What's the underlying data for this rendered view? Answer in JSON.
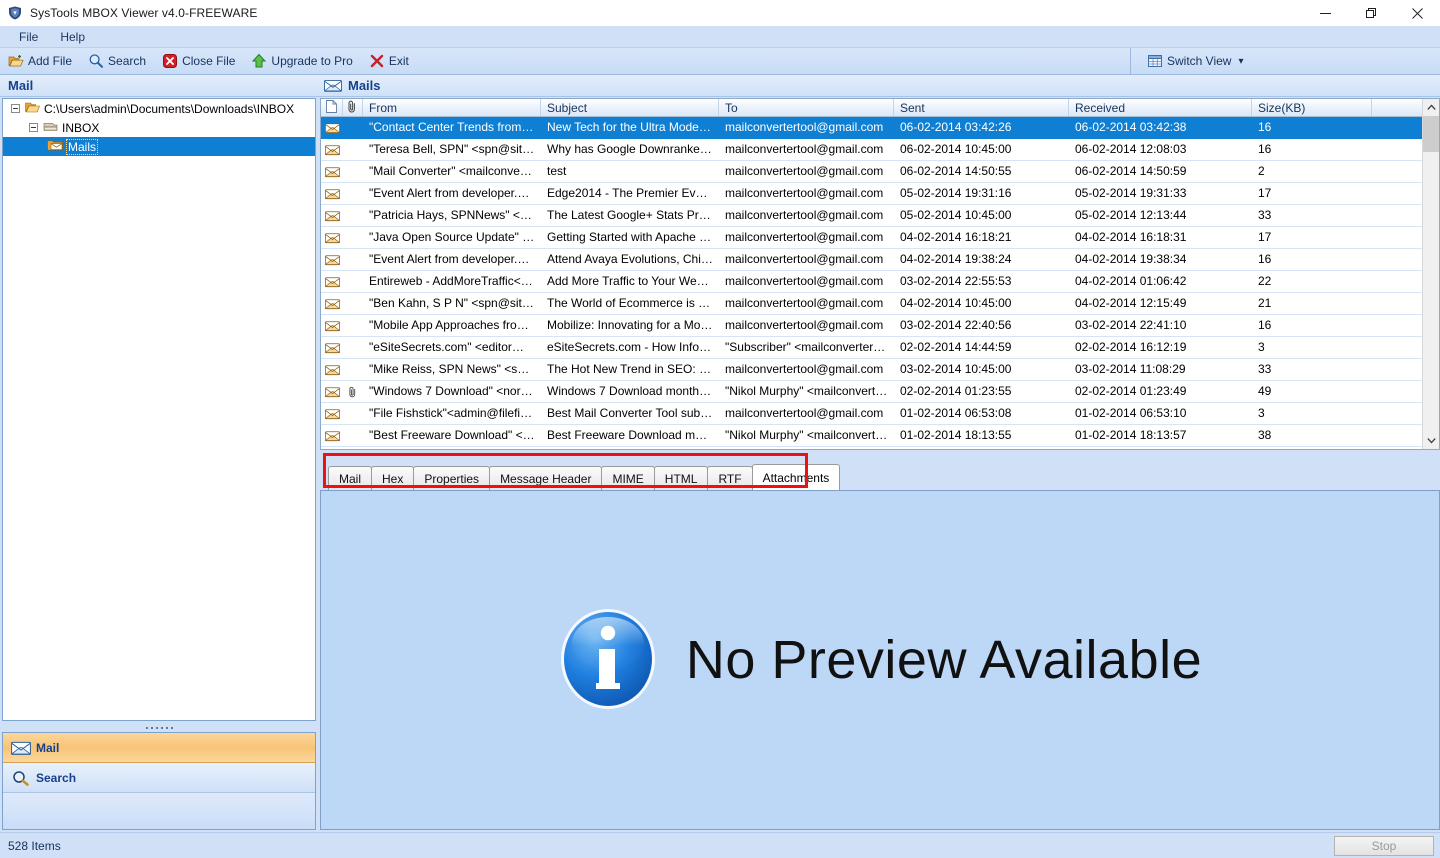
{
  "window": {
    "title": "SysTools MBOX Viewer v4.0-FREEWARE",
    "app_icon": "shield-icon",
    "minimize_label": "Minimize",
    "maximize_label": "Restore",
    "close_label": "Close"
  },
  "menubar": {
    "items": [
      {
        "label": "File",
        "name": "menu-file"
      },
      {
        "label": "Help",
        "name": "menu-help"
      }
    ]
  },
  "toolbar": {
    "buttons": [
      {
        "label": "Add File",
        "icon": "open-folder-icon"
      },
      {
        "label": "Search",
        "icon": "magnifier-icon"
      },
      {
        "label": "Close File",
        "icon": "close-red-icon"
      },
      {
        "label": "Upgrade to Pro",
        "icon": "green-up-arrow-icon"
      },
      {
        "label": "Exit",
        "icon": "red-x-icon"
      }
    ],
    "switch_view": {
      "label": "Switch View",
      "icon": "grid-icon",
      "caret": "▾"
    }
  },
  "left_pane": {
    "header": "Mail",
    "tree": [
      {
        "label": "C:\\Users\\admin\\Documents\\Downloads\\INBOX",
        "level": 1,
        "icon": "folder-icon",
        "expanded": true,
        "selected": false
      },
      {
        "label": "INBOX",
        "level": 2,
        "icon": "mbox-file-icon",
        "expanded": true,
        "selected": false
      },
      {
        "label": "Mails",
        "level": 3,
        "icon": "mail-folder-icon",
        "expanded": false,
        "selected": true
      }
    ],
    "nav_buttons": [
      {
        "label": "Mail",
        "icon": "envelope-icon",
        "active": true
      },
      {
        "label": "Search",
        "icon": "magnifier-icon",
        "active": false
      }
    ]
  },
  "mail_list": {
    "header": "Mails",
    "header_icon": "envelope-icon",
    "columns": [
      {
        "key": "icon",
        "label": "",
        "cls": "c-icon"
      },
      {
        "key": "clip",
        "label": "",
        "cls": "c-clip"
      },
      {
        "key": "from",
        "label": "From",
        "cls": "c-from"
      },
      {
        "key": "subject",
        "label": "Subject",
        "cls": "c-subject"
      },
      {
        "key": "to",
        "label": "To",
        "cls": "c-to"
      },
      {
        "key": "sent",
        "label": "Sent",
        "cls": "c-sent"
      },
      {
        "key": "received",
        "label": "Received",
        "cls": "c-recv"
      },
      {
        "key": "size",
        "label": "Size(KB)",
        "cls": "c-size"
      }
    ],
    "rows": [
      {
        "selected": true,
        "attachment": false,
        "from": "\"Contact Center Trends from de...",
        "subject": "New Tech for the Ultra Modern...",
        "to": "mailconvertertool@gmail.com",
        "sent": "06-02-2014 03:42:26",
        "received": "06-02-2014 03:42:38",
        "size": "16"
      },
      {
        "selected": false,
        "attachment": false,
        "from": "\"Teresa Bell, SPN\" <spn@sitepr...",
        "subject": "Why has Google Downranked ...",
        "to": "mailconvertertool@gmail.com",
        "sent": "06-02-2014 10:45:00",
        "received": "06-02-2014 12:08:03",
        "size": "16"
      },
      {
        "selected": false,
        "attachment": false,
        "from": "\"Mail Converter\" <mailconverte...",
        "subject": "test",
        "to": "mailconvertertool@gmail.com",
        "sent": "06-02-2014 14:50:55",
        "received": "06-02-2014 14:50:59",
        "size": "2"
      },
      {
        "selected": false,
        "attachment": false,
        "from": "\"Event Alert from developer.co...",
        "subject": "Edge2014 - The Premier Event f...",
        "to": "mailconvertertool@gmail.com",
        "sent": "05-02-2014 19:31:16",
        "received": "05-02-2014 19:31:33",
        "size": "17"
      },
      {
        "selected": false,
        "attachment": false,
        "from": "\"Patricia Hays, SPNNews\" <spn...",
        "subject": "The Latest Google+ Stats Prove...",
        "to": "mailconvertertool@gmail.com",
        "sent": "05-02-2014 10:45:00",
        "received": "05-02-2014 12:13:44",
        "size": "33"
      },
      {
        "selected": false,
        "attachment": false,
        "from": "\"Java Open Source Update\" <n...",
        "subject": "Getting Started with Apache H...",
        "to": "mailconvertertool@gmail.com",
        "sent": "04-02-2014 16:18:21",
        "received": "04-02-2014 16:18:31",
        "size": "17"
      },
      {
        "selected": false,
        "attachment": false,
        "from": "\"Event Alert from developer.co...",
        "subject": "Attend Avaya Evolutions, Chica...",
        "to": "mailconvertertool@gmail.com",
        "sent": "04-02-2014 19:38:24",
        "received": "04-02-2014 19:38:34",
        "size": "16"
      },
      {
        "selected": false,
        "attachment": false,
        "from": "Entireweb - AddMoreTraffic<d...",
        "subject": "Add More Traffic to Your Websi...",
        "to": "mailconvertertool@gmail.com",
        "sent": "03-02-2014 22:55:53",
        "received": "04-02-2014 01:06:42",
        "size": "22"
      },
      {
        "selected": false,
        "attachment": false,
        "from": "\"Ben Kahn, S P N\" <spn@sitepr...",
        "subject": "The World of Ecommerce is Ch...",
        "to": "mailconvertertool@gmail.com",
        "sent": "04-02-2014 10:45:00",
        "received": "04-02-2014 12:15:49",
        "size": "21"
      },
      {
        "selected": false,
        "attachment": false,
        "from": "\"Mobile App Approaches from ...",
        "subject": "Mobilize: Innovating for a Mob...",
        "to": "mailconvertertool@gmail.com",
        "sent": "03-02-2014 22:40:56",
        "received": "03-02-2014 22:41:10",
        "size": "16"
      },
      {
        "selected": false,
        "attachment": false,
        "from": "\"eSiteSecrets.com\" <editor@esi...",
        "subject": "eSiteSecrets.com - How Inform...",
        "to": "\"Subscriber\" <mailconvertertoo...",
        "sent": "02-02-2014 14:44:59",
        "received": "02-02-2014 16:12:19",
        "size": "3"
      },
      {
        "selected": false,
        "attachment": false,
        "from": "\"Mike Reiss, SPN News\" <spn@...",
        "subject": "The Hot New Trend in SEO: Se...",
        "to": "mailconvertertool@gmail.com",
        "sent": "03-02-2014 10:45:00",
        "received": "03-02-2014 11:08:29",
        "size": "33"
      },
      {
        "selected": false,
        "attachment": true,
        "from": "\"Windows 7 Download\" <nore...",
        "subject": "Windows 7 Download monthly...",
        "to": "\"Nikol Murphy\" <mailconverter...",
        "sent": "02-02-2014 01:23:55",
        "received": "02-02-2014 01:23:49",
        "size": "49"
      },
      {
        "selected": false,
        "attachment": false,
        "from": "\"File Fishstick\"<admin@filefish...",
        "subject": "Best Mail Converter Tool submi...",
        "to": "mailconvertertool@gmail.com",
        "sent": "01-02-2014 06:53:08",
        "received": "01-02-2014 06:53:10",
        "size": "3"
      },
      {
        "selected": false,
        "attachment": false,
        "from": "\"Best Freeware Download\" <n...",
        "subject": "Best Freeware Download mont...",
        "to": "\"Nikol Murphy\" <mailconverter...",
        "sent": "01-02-2014 18:13:55",
        "received": "01-02-2014 18:13:57",
        "size": "38"
      }
    ],
    "scrollbar": {
      "up_arrow": "˄",
      "down_arrow": "˅"
    }
  },
  "tabs": {
    "highlighted": true,
    "highlight_color": "#ee1111",
    "items": [
      {
        "label": "Mail",
        "active": false
      },
      {
        "label": "Hex",
        "active": false
      },
      {
        "label": "Properties",
        "active": false
      },
      {
        "label": "Message Header",
        "active": false
      },
      {
        "label": "MIME",
        "active": false
      },
      {
        "label": "HTML",
        "active": false
      },
      {
        "label": "RTF",
        "active": false
      },
      {
        "label": "Attachments",
        "active": true
      }
    ]
  },
  "preview": {
    "icon": "info-icon",
    "message": "No Preview Available"
  },
  "statusbar": {
    "items_text": "528 Items",
    "stop_label": "Stop",
    "stop_enabled": false
  },
  "colors": {
    "selection_blue": "#0f7fd4",
    "chrome_blue": "#cfe0f7",
    "preview_blue": "#bdd7f7",
    "accent_orange": "#f8c477",
    "highlight_red": "#ee1111",
    "header_text": "#15428b"
  }
}
